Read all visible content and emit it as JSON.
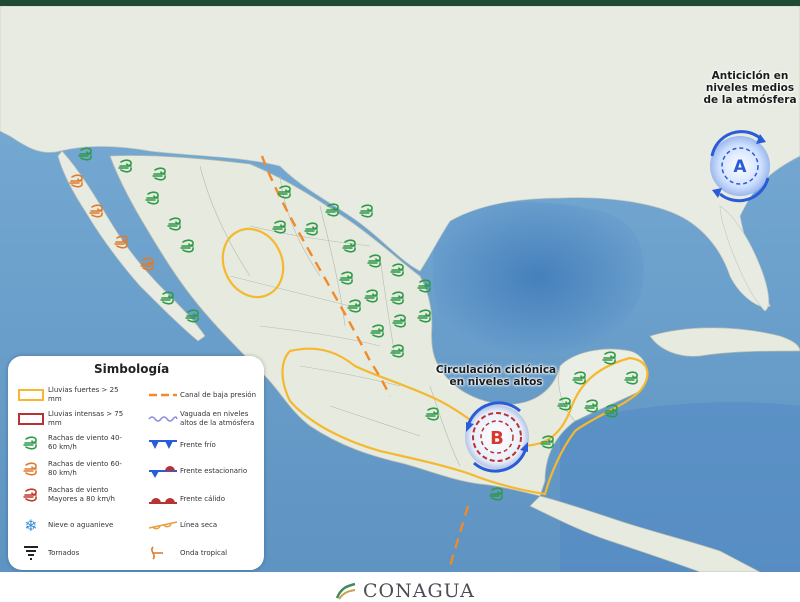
{
  "annotations": {
    "anticyclone": "Anticiclón en niveles medios de la atmósfera",
    "cyclonic": "Circulación ciclónica en niveles altos",
    "high_letter": "A",
    "low_letter": "B"
  },
  "legend": {
    "title": "Simbología",
    "items": [
      {
        "icon": "yellow-rectangle-icon",
        "label": "Lluvias fuertes > 25 mm"
      },
      {
        "icon": "red-rectangle-icon",
        "label": "Lluvias intensas > 75 mm"
      },
      {
        "icon": "green-wind-gust-icon",
        "label": "Rachas de viento 40-60 km/h"
      },
      {
        "icon": "orange-wind-gust-icon",
        "label": "Rachas de viento 60-80 km/h"
      },
      {
        "icon": "red-wind-gust-icon",
        "label": "Rachas de viento Mayores a 80 km/h"
      },
      {
        "icon": "snowflake-icon",
        "label": "Nieve o aguanieve"
      },
      {
        "icon": "tornado-icon",
        "label": "Tornados"
      },
      {
        "icon": "orange-dashed-line-icon",
        "label": "Canal de baja presión"
      },
      {
        "icon": "scalloped-trough-icon",
        "label": "Vaguada en niveles altos de la atmósfera"
      },
      {
        "icon": "cold-front-icon",
        "label": "Frente frío"
      },
      {
        "icon": "stationary-front-icon",
        "label": "Frente estacionario"
      },
      {
        "icon": "warm-front-icon",
        "label": "Frente cálido"
      },
      {
        "icon": "dry-line-icon",
        "label": "Línea seca"
      },
      {
        "icon": "tropical-wave-icon",
        "label": "Onda tropical"
      }
    ]
  },
  "colors": {
    "ocean": "#6fa3cf",
    "land": "#e9ece4",
    "rain_strong": "#f5b82e",
    "rain_intense": "#b93232",
    "gust_green": "#2f9a48",
    "gust_orange": "#e07b2e",
    "gust_red": "#c0392b",
    "low_pressure_channel": "#f08a2a",
    "circulation_blue": "#2a5bd8",
    "header": "#1f4a35"
  },
  "footer": {
    "brand": "CONAGUA"
  }
}
